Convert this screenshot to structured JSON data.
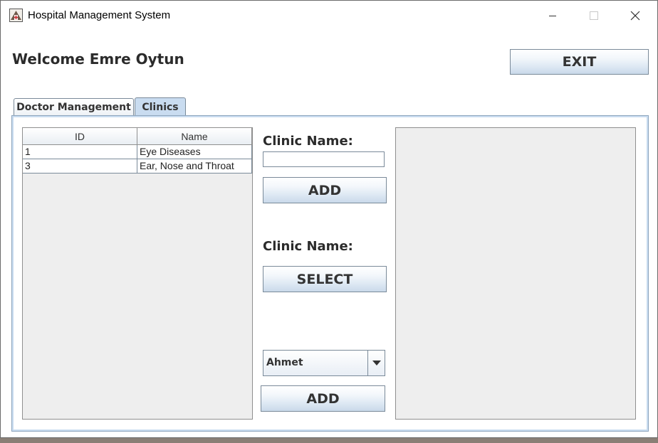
{
  "window": {
    "title": "Hospital Management System",
    "icon": "hospital-app-icon"
  },
  "header": {
    "welcome": "Welcome Emre Oytun",
    "exit_label": "EXIT"
  },
  "tabs": [
    {
      "label": "Doctor Management",
      "selected": false
    },
    {
      "label": "Clinics",
      "selected": true
    }
  ],
  "clinic_table": {
    "columns": [
      "ID",
      "Name"
    ],
    "rows": [
      [
        "1",
        "Eye Diseases"
      ],
      [
        "3",
        "Ear, Nose and Throat"
      ]
    ]
  },
  "add_clinic": {
    "label": "Clinic Name:",
    "input_value": "",
    "button_label": "ADD"
  },
  "select_clinic": {
    "label": "Clinic Name:",
    "button_label": "SELECT"
  },
  "assign_doctor": {
    "selected_doctor": "Ahmet",
    "button_label": "ADD"
  },
  "colors": {
    "accent": "#c9dcf0",
    "panel_background": "#eeeeee",
    "border": "#7a8a99"
  }
}
